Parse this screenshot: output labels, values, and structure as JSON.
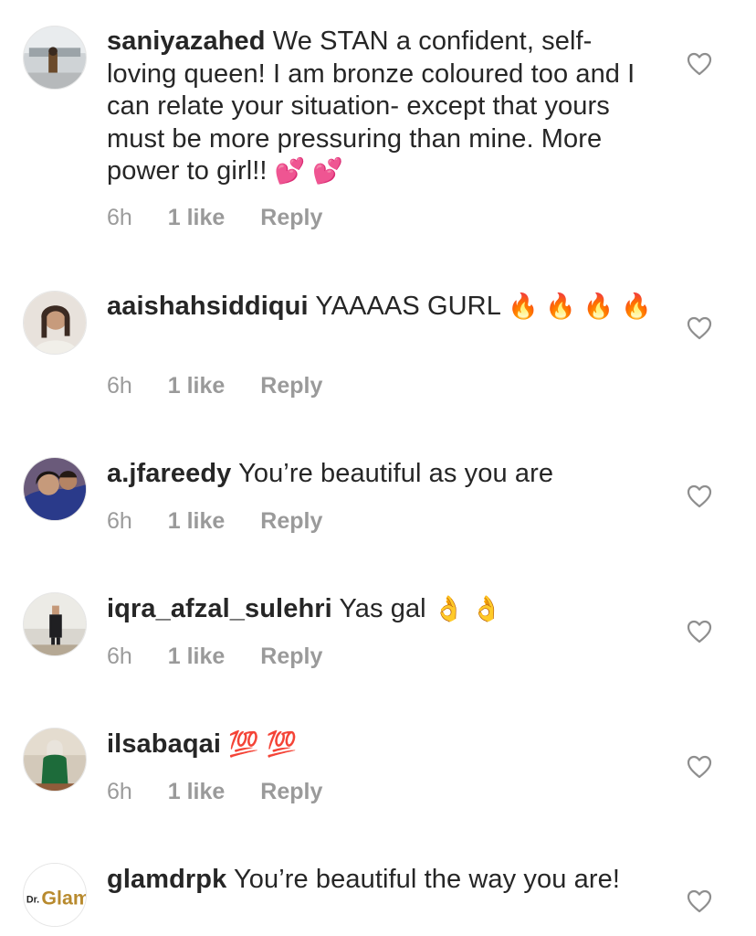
{
  "comments": [
    {
      "username": "saniyazahed",
      "text": "We STAN a confident, self-loving queen! I am bronze coloured too and I can relate your situation- except that yours must be more pressuring than mine. More power to girl!!",
      "emoji": "💕 💕",
      "time": "6h",
      "likes": "1 like",
      "reply": "Reply",
      "avatar": "photo-avatar"
    },
    {
      "username": "aaishahsiddiqui",
      "text": "YAAAAS GURL",
      "emoji": "🔥 🔥 🔥 🔥",
      "time": "6h",
      "likes": "1 like",
      "reply": "Reply",
      "avatar": "photo-avatar"
    },
    {
      "username": "a.jfareedy",
      "text": "You’re beautiful as you are",
      "emoji": "",
      "time": "6h",
      "likes": "1 like",
      "reply": "Reply",
      "avatar": "photo-avatar"
    },
    {
      "username": "iqra_afzal_sulehri",
      "text": "Yas gal",
      "emoji": "👌 👌",
      "time": "6h",
      "likes": "1 like",
      "reply": "Reply",
      "avatar": "photo-avatar"
    },
    {
      "username": "ilsabaqai",
      "text": "",
      "emoji": "💯 💯",
      "time": "6h",
      "likes": "1 like",
      "reply": "Reply",
      "avatar": "photo-avatar"
    },
    {
      "username": "glamdrpk",
      "text": "You’re beautiful the way you are!",
      "emoji": "",
      "time": "",
      "likes": "",
      "reply": "",
      "avatar": "Dr.Glam logo"
    }
  ],
  "colors": {
    "text": "#262626",
    "meta": "#9b9b9b",
    "heart": "#8e8e8e"
  }
}
